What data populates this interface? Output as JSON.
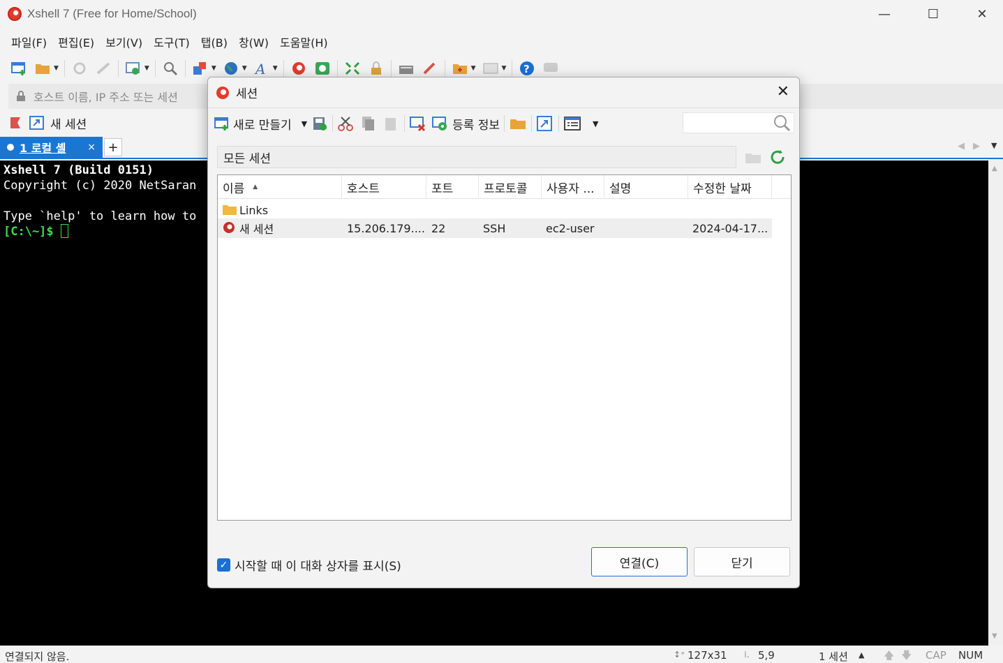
{
  "window": {
    "title": "Xshell 7 (Free for Home/School)"
  },
  "menu": [
    "파일(F)",
    "편집(E)",
    "보기(V)",
    "도구(T)",
    "탭(B)",
    "창(W)",
    "도움말(H)"
  ],
  "address": {
    "placeholder": "호스트 이름, IP 주소 또는 세션"
  },
  "links_bar": {
    "session_label": "새 세션"
  },
  "tab": {
    "label": "1 로컬 셸",
    "close": "×",
    "add": "+"
  },
  "terminal": {
    "line1": "Xshell 7 (Build 0151)",
    "line2": "Copyright (c) 2020 NetSaran",
    "line3": "",
    "line4": "Type `help' to learn how to",
    "prompt": "[C:\\~]$ "
  },
  "status": {
    "text": "연결되지 않음.",
    "size": "127x31",
    "cursor_pos": "5,9",
    "sessions": "1 세션",
    "cap": "CAP",
    "num": "NUM"
  },
  "dialog": {
    "title": "세션",
    "new_label": "새로 만들기",
    "properties_label": "등록 정보",
    "path": "모든 세션",
    "columns": [
      "이름",
      "호스트",
      "포트",
      "프로토콜",
      "사용자 ...",
      "설명",
      "수정한 날짜"
    ],
    "folder": {
      "name": "Links"
    },
    "session": {
      "name": "새 세션",
      "host": "15.206.179....",
      "port": "22",
      "protocol": "SSH",
      "user": "ec2-user",
      "description": "",
      "modified": "2024-04-17..."
    },
    "show_on_startup": "시작할 때 이 대화 상자를 표시(S)",
    "connect": "연결(C)",
    "close": "닫기"
  },
  "colors": {
    "accent": "#1b76d2",
    "prompt_green": "#3adf4f",
    "brand_red": "#e23b2d"
  }
}
